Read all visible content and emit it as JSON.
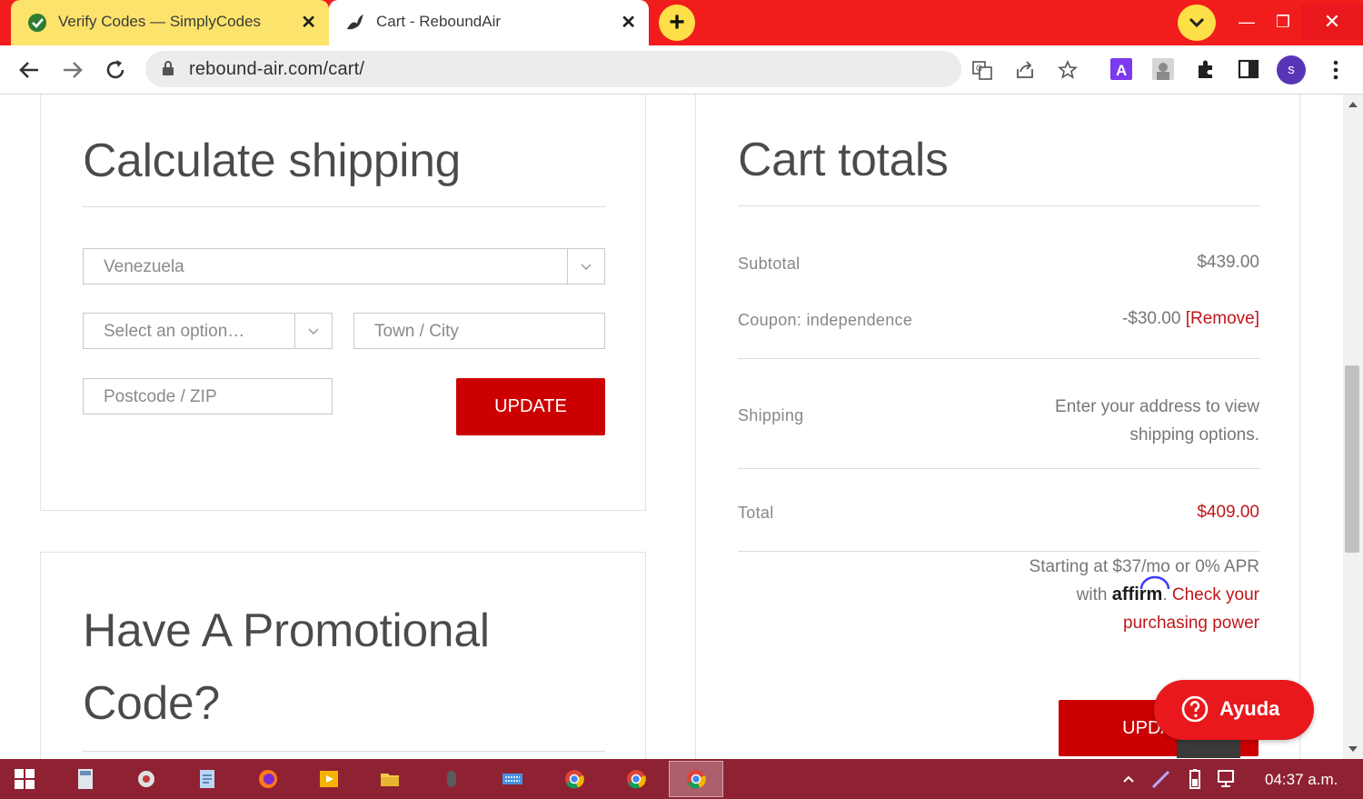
{
  "browser": {
    "tabs": [
      {
        "title": "Verify Codes — SimplyCodes",
        "active": false
      },
      {
        "title": "Cart - ReboundAir",
        "active": true
      }
    ],
    "url": "rebound-air.com/cart/",
    "profile_initial": "s",
    "colors": {
      "tabstrip": "#f11c1c",
      "inactive_tab": "#fce36b",
      "accent_button": "#fde047"
    }
  },
  "shipping": {
    "heading": "Calculate shipping",
    "country_value": "Venezuela",
    "state_placeholder": "Select an option…",
    "city_placeholder": "Town / City",
    "postcode_placeholder": "Postcode / ZIP",
    "update_label": "UPDATE"
  },
  "promo": {
    "heading_line1": "Have A Promotional",
    "heading_line2": "Code?"
  },
  "totals": {
    "heading": "Cart totals",
    "subtotal_label": "Subtotal",
    "subtotal_value": "$439.00",
    "coupon_label": "Coupon: independence",
    "coupon_value": "-$30.00",
    "coupon_remove": "[Remove]",
    "shipping_label": "Shipping",
    "shipping_line1": "Enter your address to view",
    "shipping_line2": "shipping options.",
    "total_label": "Total",
    "total_value": "$409.00",
    "affirm_line1": "Starting at $37/mo or 0% APR",
    "affirm_with": "with",
    "affirm_brand": "affirm",
    "affirm_link_a": "Check your",
    "affirm_link_b": "purchasing power",
    "update_label": "UPDATE",
    "accent_color": "#cc0000"
  },
  "help": {
    "label": "Ayuda"
  },
  "taskbar": {
    "clock": "04:37 a.m."
  }
}
